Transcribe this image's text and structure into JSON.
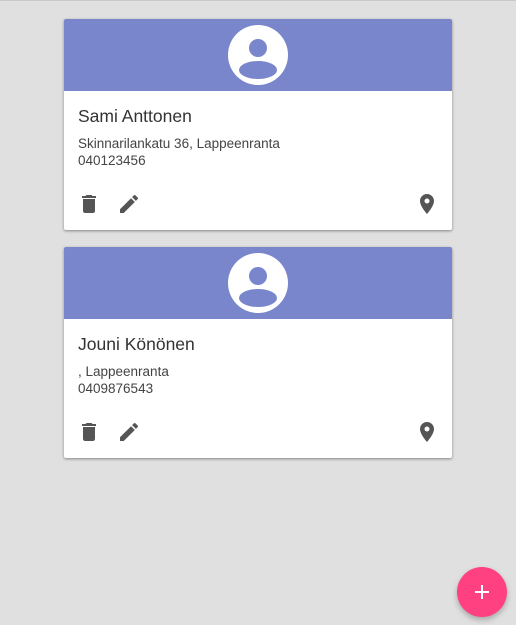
{
  "colors": {
    "header_bg": "#7986cb",
    "fab_bg": "#ff4081",
    "page_bg": "#e0e0e0",
    "icon": "#555555"
  },
  "contacts": [
    {
      "name": "Sami Anttonen",
      "address": "Skinnarilankatu 36, Lappeenranta",
      "phone": "040123456",
      "avatar_icon": "account-circle-icon"
    },
    {
      "name": "Jouni Könönen",
      "address": ", Lappeenranta",
      "phone": "0409876543",
      "avatar_icon": "account-circle-icon"
    }
  ],
  "card_actions": {
    "delete_icon": "trash-icon",
    "edit_icon": "pencil-icon",
    "map_icon": "map-pin-icon"
  },
  "fab": {
    "icon": "plus-icon"
  }
}
